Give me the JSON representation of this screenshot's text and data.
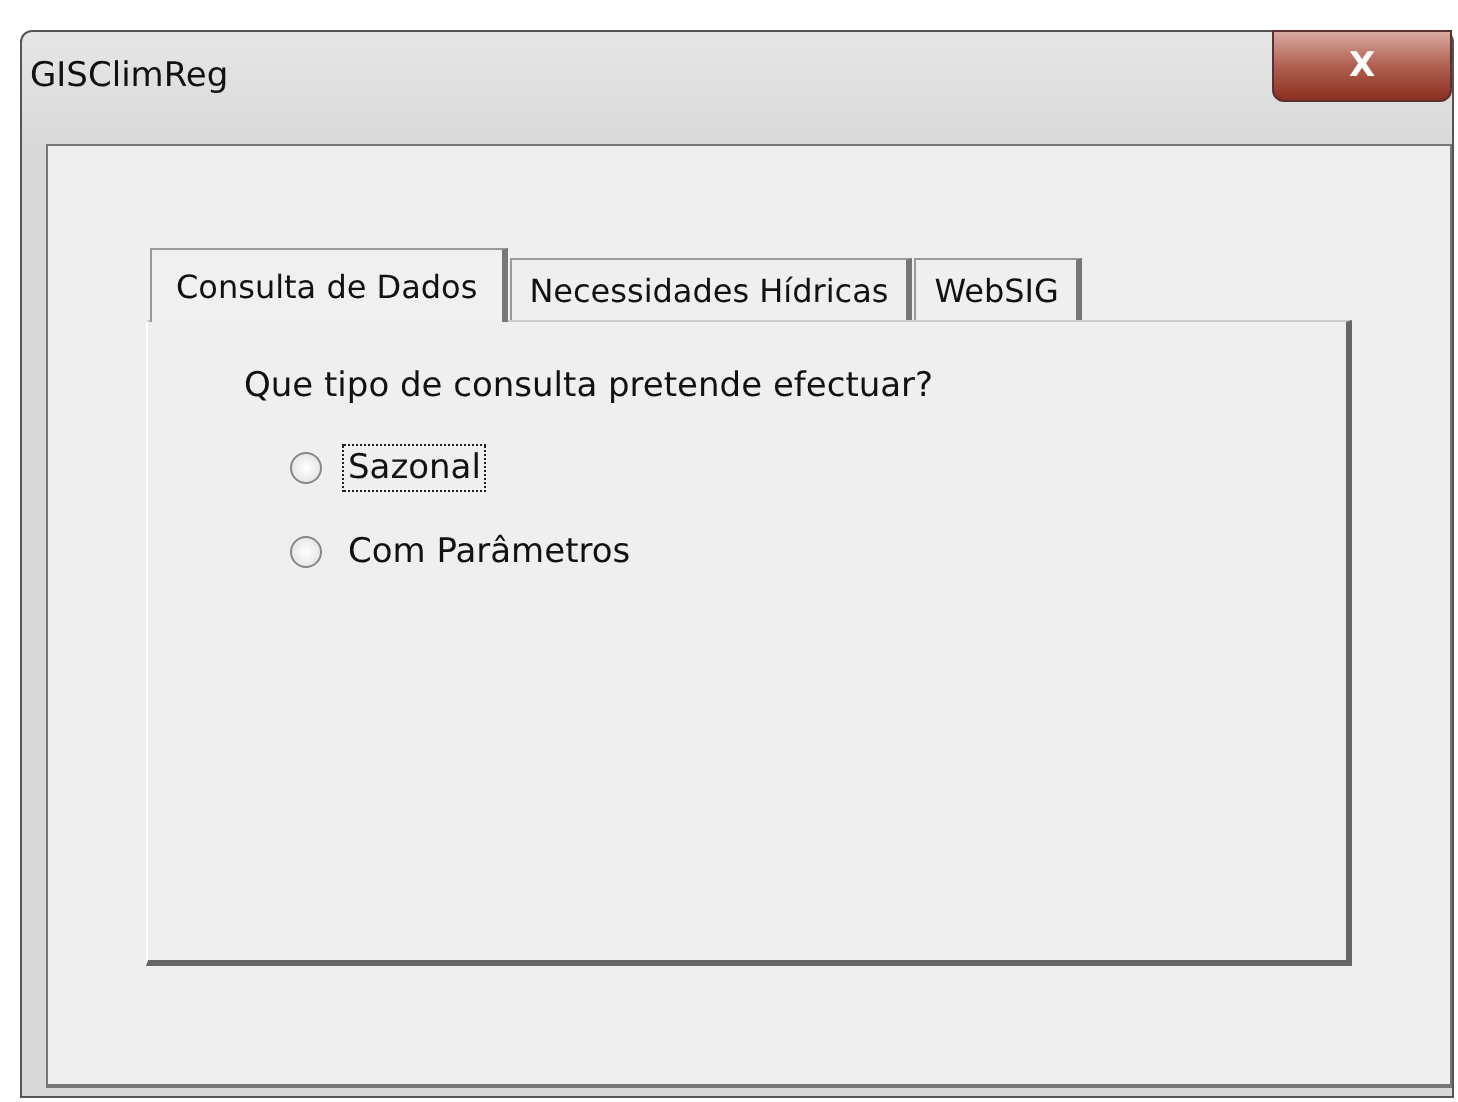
{
  "window": {
    "title": "GISClimReg",
    "close_label": "X"
  },
  "tabs": [
    {
      "label": "Consulta de Dados",
      "selected": true
    },
    {
      "label": "Necessidades Hídricas",
      "selected": false
    },
    {
      "label": "WebSIG",
      "selected": false
    }
  ],
  "question": "Que tipo de consulta pretende efectuar?",
  "options": [
    {
      "label": "Sazonal",
      "selected": false,
      "focused": true
    },
    {
      "label": "Com Parâmetros",
      "selected": false,
      "focused": false
    }
  ]
}
